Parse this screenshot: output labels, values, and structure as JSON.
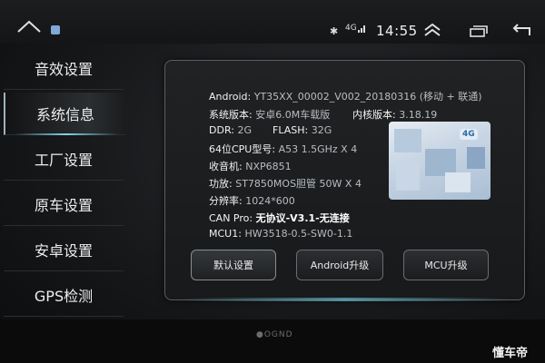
{
  "statusbar": {
    "bluetooth_icon": "bluetooth-icon",
    "signal_text": "4G",
    "time": "14:55"
  },
  "sidebar": {
    "items": [
      {
        "label": "音效设置"
      },
      {
        "label": "系统信息",
        "active": true
      },
      {
        "label": "工厂设置"
      },
      {
        "label": "原车设置"
      },
      {
        "label": "安卓设置"
      },
      {
        "label": "GPS检测"
      }
    ]
  },
  "system_info": {
    "android_label": "Android:",
    "android_value": "YT35XX_00002_V002_20180316 (移动 + 联通)",
    "sysver_label": "系统版本:",
    "sysver_value": "安卓6.0M车载版",
    "kernel_label": "内核版本:",
    "kernel_value": "3.18.19",
    "ddr_label": "DDR:",
    "ddr_value": "2G",
    "flash_label": "FLASH:",
    "flash_value": "32G",
    "cpu_label": "64位CPU型号:",
    "cpu_value": "A53 1.5GHz X 4",
    "radio_label": "收音机:",
    "radio_value": "NXP6851",
    "amp_label": "功放:",
    "amp_value": "ST7850MOS胆管 50W X 4",
    "res_label": "分辨率:",
    "res_value": "1024*600",
    "canpro_label": "CAN Pro:",
    "canpro_value": "无协议-V3.1-无连接",
    "mcu_label": "MCU1:",
    "mcu_value": "HW3518-0.5-SW0-1.1"
  },
  "thumbnail": {
    "badge": "4G"
  },
  "buttons": {
    "default": "默认设置",
    "android_upgrade": "Android升级",
    "mcu_upgrade": "MCU升级"
  },
  "footer": {
    "brand": "●OGND",
    "watermark": "懂车帝"
  },
  "colors": {
    "accent_glow": "#67b9c9",
    "app_icon": "#7fa9d6"
  }
}
